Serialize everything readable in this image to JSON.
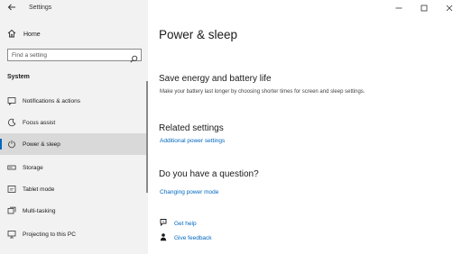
{
  "app": {
    "title": "Settings"
  },
  "sidebar": {
    "home_label": "Home",
    "search_placeholder": "Find a setting",
    "section": "System",
    "items": [
      {
        "label": "Notifications & actions",
        "icon": "notifications-icon"
      },
      {
        "label": "Focus assist",
        "icon": "focus-assist-icon"
      },
      {
        "label": "Power & sleep",
        "icon": "power-icon",
        "selected": true
      },
      {
        "label": "Storage",
        "icon": "storage-icon"
      },
      {
        "label": "Tablet mode",
        "icon": "tablet-mode-icon"
      },
      {
        "label": "Multi-tasking",
        "icon": "multitasking-icon"
      },
      {
        "label": "Projecting to this PC",
        "icon": "projecting-icon"
      }
    ]
  },
  "main": {
    "title": "Power & sleep",
    "save_energy": {
      "heading": "Save energy and battery life",
      "description": "Make your battery last longer by choosing shorter times for screen and sleep settings."
    },
    "related": {
      "heading": "Related settings",
      "link": "Additional power settings"
    },
    "question": {
      "heading": "Do you have a question?",
      "link": "Changing power mode"
    },
    "help": {
      "get_help": "Get help",
      "give_feedback": "Give feedback"
    }
  },
  "colors": {
    "accent": "#0067c0",
    "sidebar_bg": "#f2f2f2",
    "selected_bg": "#d9d9d9"
  }
}
